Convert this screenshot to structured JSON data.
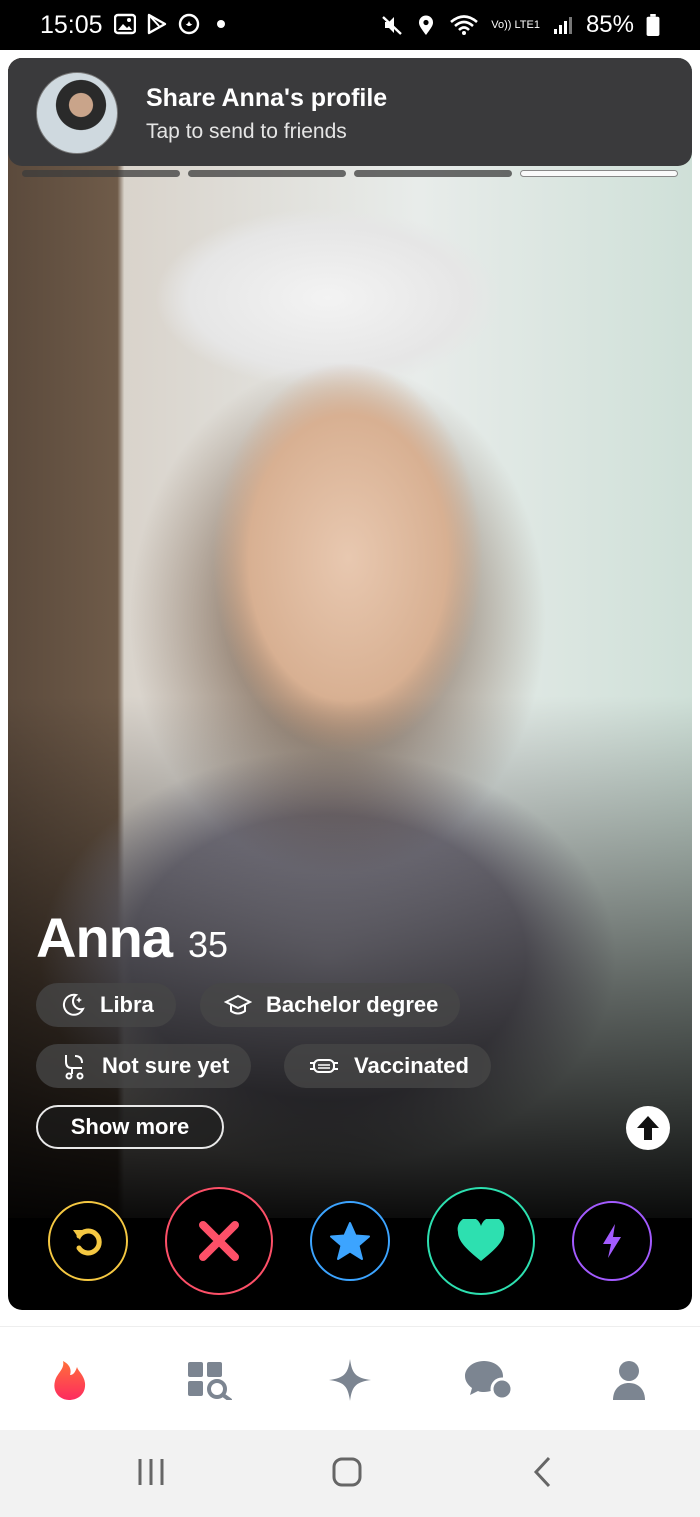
{
  "status_bar": {
    "time": "15:05",
    "left_icons": [
      "gallery-icon",
      "play-store-icon",
      "tinder-notification-icon",
      "dot-icon"
    ],
    "right_icons": [
      "mute-icon",
      "location-icon",
      "wifi-icon",
      "volte-signal-icon"
    ],
    "volte_label": "Vo)) LTE1",
    "battery": "85%"
  },
  "notification": {
    "title": "Share Anna's profile",
    "subtitle": "Tap to send to friends"
  },
  "profile": {
    "photo_count": 4,
    "active_photo_index": 3,
    "name": "Anna",
    "age": "35",
    "chips": [
      {
        "icon": "moon-icon",
        "label": "Libra"
      },
      {
        "icon": "graduation-cap-icon",
        "label": "Bachelor degree"
      },
      {
        "icon": "family-plans-icon",
        "label": "Not sure yet"
      },
      {
        "icon": "mask-icon",
        "label": "Vaccinated"
      }
    ],
    "show_more_label": "Show more"
  },
  "actions": [
    {
      "name": "rewind",
      "icon": "rewind-icon",
      "color": "#f5c842"
    },
    {
      "name": "nope",
      "icon": "close-icon",
      "color": "#fd5068"
    },
    {
      "name": "super-like",
      "icon": "star-icon",
      "color": "#3ca4ff"
    },
    {
      "name": "like",
      "icon": "heart-icon",
      "color": "#2de0b0"
    },
    {
      "name": "boost",
      "icon": "lightning-icon",
      "color": "#a35bff"
    }
  ],
  "bottom_nav": [
    {
      "name": "discover",
      "icon": "flame-icon",
      "active": true
    },
    {
      "name": "explore",
      "icon": "explore-grid-icon",
      "active": false
    },
    {
      "name": "gold-home",
      "icon": "sparkle-icon",
      "active": false
    },
    {
      "name": "messages",
      "icon": "chat-icon",
      "active": false
    },
    {
      "name": "profile",
      "icon": "person-icon",
      "active": false
    }
  ],
  "colors": {
    "brand": "#fd5068",
    "nav_inactive": "#7c8591",
    "chip_bg": "#464646"
  }
}
